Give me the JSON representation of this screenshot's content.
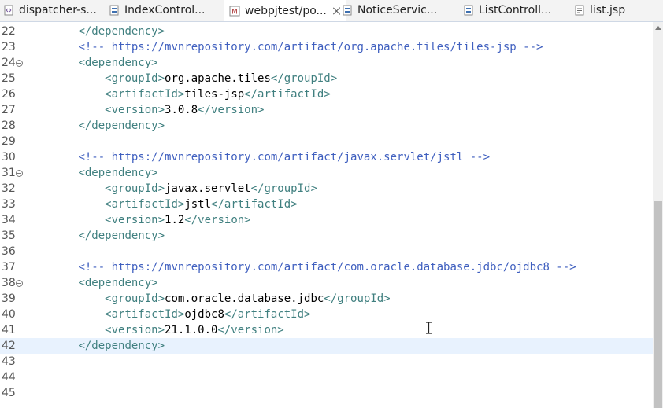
{
  "tabs": [
    {
      "label": "dispatcher-s...",
      "icon": "xml-file-icon",
      "active": false
    },
    {
      "label": "IndexControl...",
      "icon": "java-file-icon",
      "active": false
    },
    {
      "label": "webpjtest/po...",
      "icon": "maven-pom-icon",
      "active": true,
      "closable": true
    },
    {
      "label": "NoticeServic...",
      "icon": "java-file-icon",
      "active": false
    },
    {
      "label": "ListControll...",
      "icon": "java-file-icon",
      "active": false
    },
    {
      "label": "list.jsp",
      "icon": "jsp-file-icon",
      "active": false
    }
  ],
  "editor": {
    "current_line": "42",
    "lines": [
      {
        "no": "22",
        "text": "        </dependency>"
      },
      {
        "no": "23",
        "text": "        <!-- https://mvnrepository.com/artifact/org.apache.tiles/tiles-jsp -->"
      },
      {
        "no": "24",
        "text": "        <dependency>",
        "fold": true
      },
      {
        "no": "25",
        "text": "            <groupId>org.apache.tiles</groupId>"
      },
      {
        "no": "26",
        "text": "            <artifactId>tiles-jsp</artifactId>"
      },
      {
        "no": "27",
        "text": "            <version>3.0.8</version>"
      },
      {
        "no": "28",
        "text": "        </dependency>"
      },
      {
        "no": "29",
        "text": ""
      },
      {
        "no": "30",
        "text": "        <!-- https://mvnrepository.com/artifact/javax.servlet/jstl -->"
      },
      {
        "no": "31",
        "text": "        <dependency>",
        "fold": true
      },
      {
        "no": "32",
        "text": "            <groupId>javax.servlet</groupId>"
      },
      {
        "no": "33",
        "text": "            <artifactId>jstl</artifactId>"
      },
      {
        "no": "34",
        "text": "            <version>1.2</version>"
      },
      {
        "no": "35",
        "text": "        </dependency>"
      },
      {
        "no": "36",
        "text": ""
      },
      {
        "no": "37",
        "text": "        <!-- https://mvnrepository.com/artifact/com.oracle.database.jdbc/ojdbc8 -->"
      },
      {
        "no": "38",
        "text": "        <dependency>",
        "fold": true
      },
      {
        "no": "39",
        "text": "            <groupId>com.oracle.database.jdbc</groupId>"
      },
      {
        "no": "40",
        "text": "            <artifactId>ojdbc8</artifactId>"
      },
      {
        "no": "41",
        "text": "            <version>21.1.0.0</version>"
      },
      {
        "no": "42",
        "text": "        </dependency>"
      },
      {
        "no": "43",
        "text": ""
      },
      {
        "no": "44",
        "text": ""
      },
      {
        "no": "45",
        "text": ""
      }
    ]
  },
  "colors": {
    "tag": "#3f7f7f",
    "comment": "#3f5fbf",
    "text": "#000000",
    "current_line_bg": "#e8f2fe"
  }
}
